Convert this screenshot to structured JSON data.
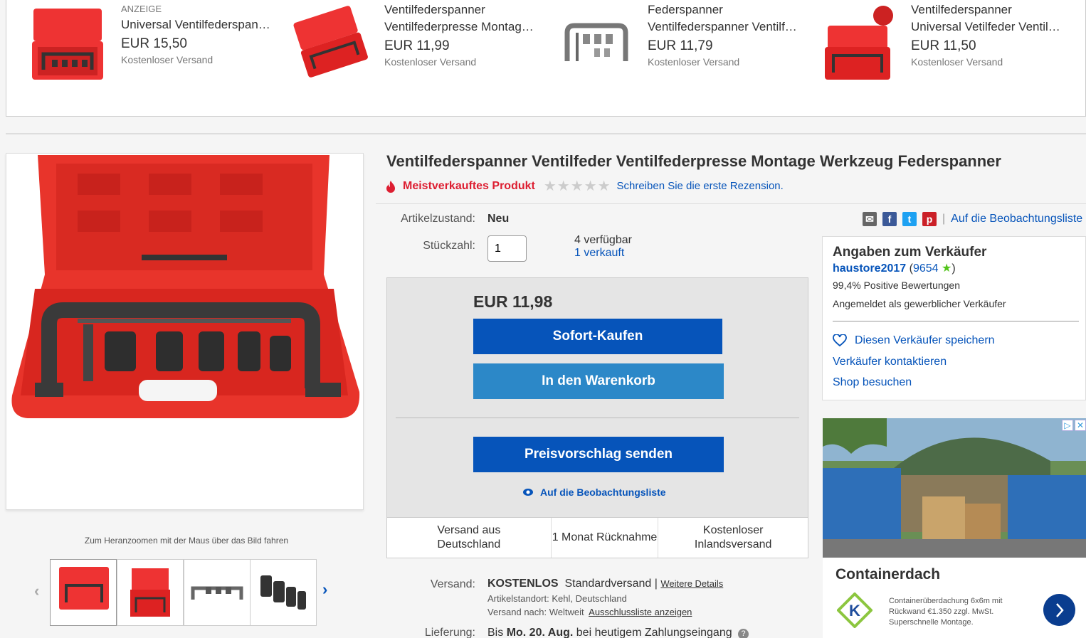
{
  "carousel": {
    "items": [
      {
        "ad_label": "ANZEIGE",
        "title": "Universal Ventilfederspan…",
        "price": "EUR 15,50",
        "shipping": "Kostenloser Versand"
      },
      {
        "ad_label": "",
        "line1": "Ventilfederspanner",
        "title": "Ventilfederpresse Montag…",
        "price": "EUR 11,99",
        "shipping": "Kostenloser Versand"
      },
      {
        "ad_label": "",
        "line1": "Federspanner",
        "title": "Ventilfederspanner Ventilf…",
        "price": "EUR 11,79",
        "shipping": "Kostenloser Versand"
      },
      {
        "ad_label": "",
        "line1": "Ventilfederspanner",
        "title": "Universal Vetilfeder Ventil…",
        "price": "EUR 11,50",
        "shipping": "Kostenloser Versand"
      }
    ]
  },
  "product": {
    "title": "Ventilfederspanner Ventilfeder Ventilfederpresse Montage Werkzeug Federspanner",
    "badge": "Meistverkauftes Produkt",
    "stars": "★★★★★",
    "review_link": "Schreiben Sie die erste Rezension.",
    "zoom_hint": "Zum Heranzoomen mit der Maus über das Bild fahren"
  },
  "details": {
    "condition_label": "Artikelzustand:",
    "condition_value": "Neu",
    "qty_label": "Stückzahl:",
    "qty_value": "1",
    "available": "4 verfügbar",
    "sold": "1 verkauft",
    "watch_link": "Auf die Beobachtungsliste"
  },
  "buybox": {
    "price": "EUR 11,98",
    "buy_now": "Sofort-Kaufen",
    "add_cart": "In den Warenkorb",
    "offer": "Preisvorschlag senden",
    "watch": "Auf die Beobachtungsliste",
    "foot": [
      "Versand aus Deutschland",
      "1 Monat Rücknahme",
      "Kostenloser Inlandsversand"
    ]
  },
  "shipping": {
    "label": "Versand:",
    "free": "KOSTENLOS",
    "type": "Standardversand |",
    "details_link": "Weitere Details",
    "location_label": "Artikelstandort:",
    "location": "Kehl, Deutschland",
    "ship_to_label": "Versand nach:",
    "ship_to": "Weltweit",
    "exclusion_link": "Ausschlussliste anzeigen",
    "delivery_label": "Lieferung:",
    "delivery_pre": "Bis",
    "delivery_date": "Mo. 20. Aug.",
    "delivery_post": "bei heutigem Zahlungseingang"
  },
  "seller": {
    "heading": "Angaben zum Verkäufer",
    "name": "haustore2017",
    "rating_count": "9654",
    "positive": "99,4% Positive Bewertungen",
    "type": "Angemeldet als gewerblicher Verkäufer",
    "save": "Diesen Verkäufer speichern",
    "contact": "Verkäufer kontaktieren",
    "shop": "Shop besuchen"
  },
  "ad": {
    "title": "Containerdach",
    "text": "Containerüberdachung 6x6m mit Rückwand €1.350 zzgl. MwSt. Superschnelle Montage.",
    "badge1": "▷",
    "badge2": "✕"
  },
  "colors": {
    "link": "#0654ba",
    "button_dark": "#0654ba",
    "button_light": "#2c88c8",
    "badge_red": "#dd1e31"
  }
}
